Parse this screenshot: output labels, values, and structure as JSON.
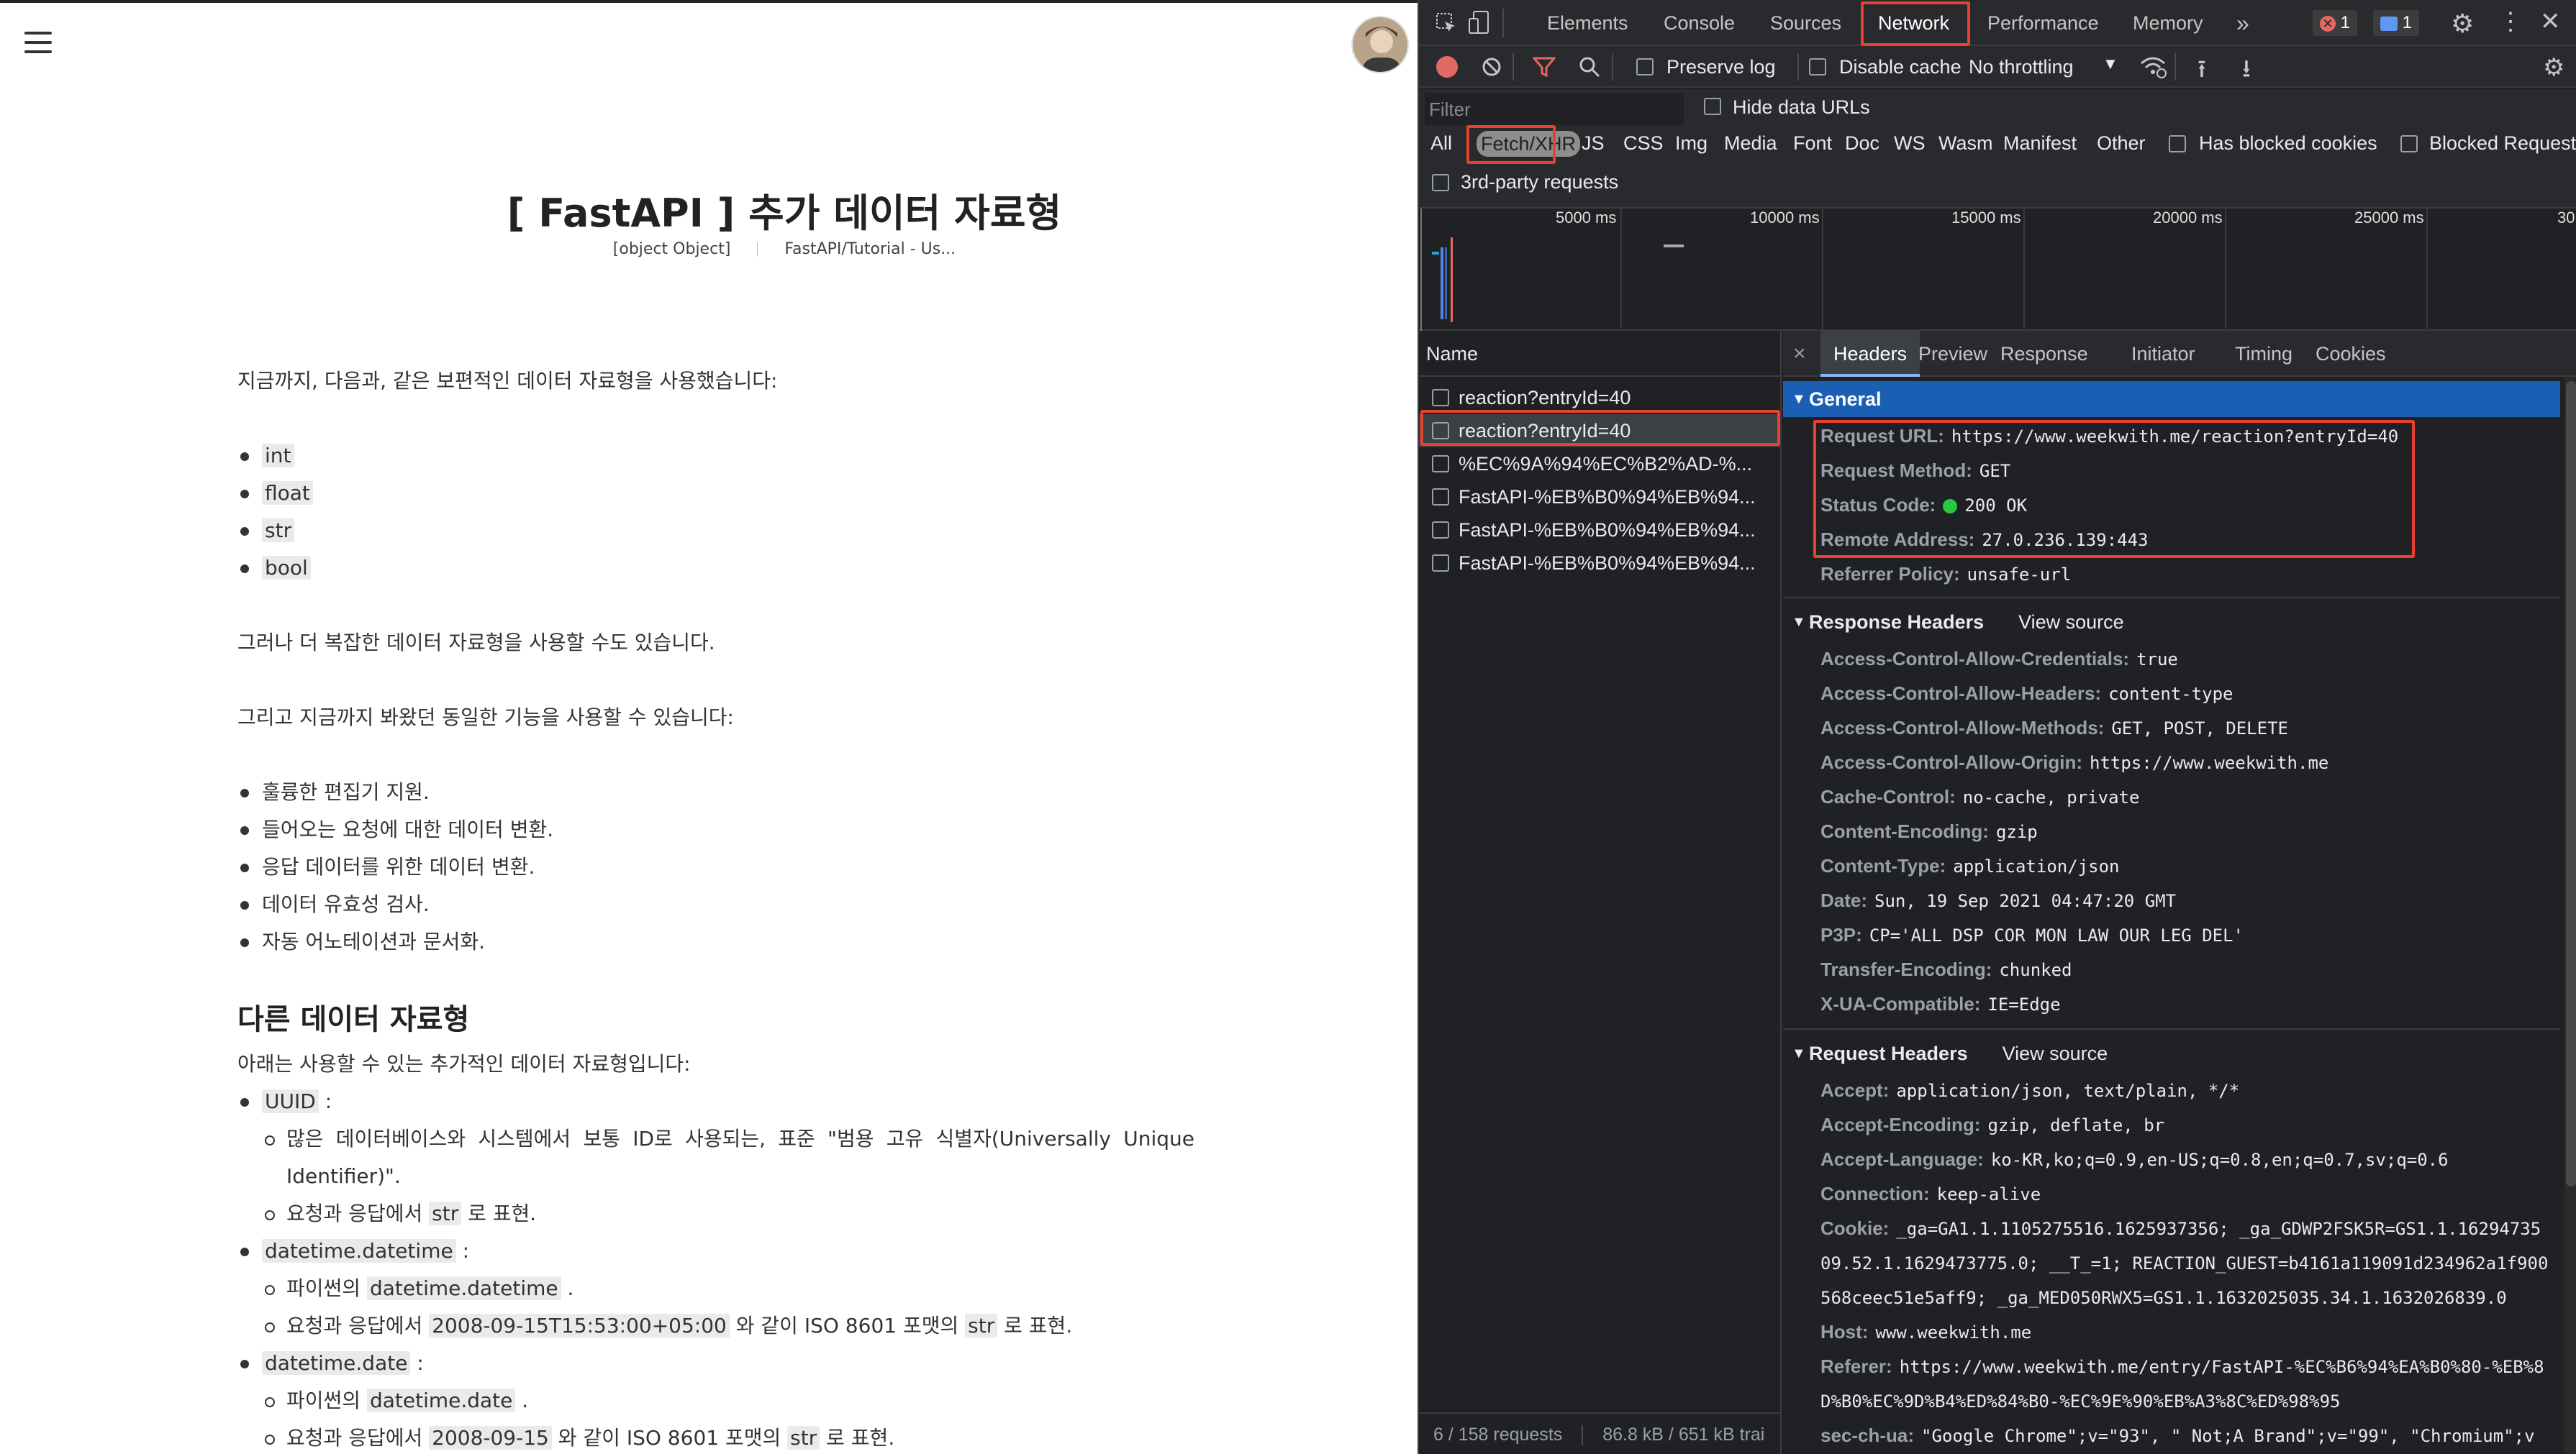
{
  "blog": {
    "title": "[ FastAPI ] 추가 데이터 자료형",
    "date": {
      "name": "datetime.date",
      "colon": " :",
      "py_pre": "파이썬의 ",
      "py_code": "datetime.date",
      "py_post": " .",
      "ex_pre": "요청과 응답에서 ",
      "ex_code": "2008-09-15",
      "ex_mid": " 와 같이 ISO 8601 포맷의 ",
      "ex_code2": "str",
      "ex_post": " 로 표현."
    },
    "category": "FastAPI/Tutorial - Us...",
    "intro": "지금까지, 다음과, 같은 보편적인 데이터 자료형을 사용했습니다:",
    "basic_types": [
      "int",
      "float",
      "str",
      "bool"
    ],
    "p2": "그러나 더 복잡한 데이터 자료형을 사용할 수도 있습니다.",
    "p3": "그리고 지금까지 봐왔던 동일한 기능을 사용할 수 있습니다:",
    "features": [
      "훌륭한 편집기 지원.",
      "들어오는 요청에 대한 데이터 변환.",
      "응답 데이터를 위한 데이터 변환.",
      "데이터 유효성 검사.",
      "자동 어노테이션과 문서화."
    ],
    "h2": "다른 데이터 자료형",
    "h2_desc": "아래는 사용할 수 있는 추가적인 데이터 자료형입니다:",
    "uuid": {
      "name": "UUID",
      "colon": " :",
      "desc": "많은 데이터베이스와 시스템에서 보통 ID로 사용되는, 표준 \"범용 고유 식별자(Universally Unique Identifier)\".",
      "repr_pre": "요청과 응답에서 ",
      "repr_code": "str",
      "repr_post": " 로 표현."
    },
    "datetime": {
      "name": "datetime.datetime",
      "colon": " :",
      "py_pre": "파이썬의 ",
      "py_code": "datetime.datetime",
      "py_post": " .",
      "ex_pre": "요청과 응답에서 ",
      "ex_code": "2008-09-15T15:53:00+05:00",
      "ex_mid": " 와 같이 ISO 8601 포맷의 ",
      "ex_code2": "str",
      "ex_post": " 로 표현."
    }
  },
  "devtools": {
    "tabs": [
      "Elements",
      "Console",
      "Sources",
      "Network",
      "Performance",
      "Memory"
    ],
    "active_tab": "Network",
    "more": "»",
    "error_count": "1",
    "message_count": "1",
    "toolbar": {
      "preserve_log": "Preserve log",
      "disable_cache": "Disable cache",
      "throttling": "No throttling"
    },
    "filter": {
      "placeholder": "Filter",
      "hide_data_urls": "Hide data URLs",
      "types": [
        "All",
        "Fetch/XHR",
        "JS",
        "CSS",
        "Img",
        "Media",
        "Font",
        "Doc",
        "WS",
        "Wasm",
        "Manifest",
        "Other"
      ],
      "active_type": "Fetch/XHR",
      "has_blocked_cookies": "Has blocked cookies",
      "blocked_requests": "Blocked Requests",
      "third_party": "3rd-party requests"
    },
    "timeline_ticks": [
      "5000 ms",
      "10000 ms",
      "15000 ms",
      "20000 ms",
      "25000 ms",
      "30"
    ],
    "requests_header": "Name",
    "requests": [
      "reaction?entryId=40",
      "reaction?entryId=40",
      "%EC%9A%94%EC%B2%AD-%...",
      "FastAPI-%EB%B0%94%EB%94...",
      "FastAPI-%EB%B0%94%EB%94...",
      "FastAPI-%EB%B0%94%EB%94..."
    ],
    "selected_request_index": 1,
    "footer_requests": "6 / 158 requests",
    "footer_size": "86.8 kB / 651 kB trai",
    "detail_tabs": [
      "Headers",
      "Preview",
      "Response",
      "Initiator",
      "Timing",
      "Cookies"
    ],
    "close_glyph": "×",
    "general": {
      "title": "General",
      "rows": [
        {
          "k": "Request URL:",
          "v": "https://www.weekwith.me/reaction?entryId=40"
        },
        {
          "k": "Request Method:",
          "v": "GET"
        },
        {
          "k": "Status Code:",
          "v": "200 OK"
        },
        {
          "k": "Remote Address:",
          "v": "27.0.236.139:443"
        },
        {
          "k": "Referrer Policy:",
          "v": "unsafe-url"
        }
      ]
    },
    "response_headers": {
      "title": "Response Headers",
      "view_source": "View source",
      "rows": [
        {
          "k": "Access-Control-Allow-Credentials:",
          "v": "true"
        },
        {
          "k": "Access-Control-Allow-Headers:",
          "v": "content-type"
        },
        {
          "k": "Access-Control-Allow-Methods:",
          "v": "GET, POST, DELETE"
        },
        {
          "k": "Access-Control-Allow-Origin:",
          "v": "https://www.weekwith.me"
        },
        {
          "k": "Cache-Control:",
          "v": "no-cache, private"
        },
        {
          "k": "Content-Encoding:",
          "v": "gzip"
        },
        {
          "k": "Content-Type:",
          "v": "application/json"
        },
        {
          "k": "Date:",
          "v": "Sun, 19 Sep 2021 04:47:20 GMT"
        },
        {
          "k": "P3P:",
          "v": "CP='ALL DSP COR MON LAW OUR LEG DEL'"
        },
        {
          "k": "Transfer-Encoding:",
          "v": "chunked"
        },
        {
          "k": "X-UA-Compatible:",
          "v": "IE=Edge"
        }
      ]
    },
    "request_headers": {
      "title": "Request Headers",
      "view_source": "View source",
      "accept_k": "Accept:",
      "accept_v": "application/json, text/plain, */*",
      "enc_k": "Accept-Encoding:",
      "enc_v": "gzip, deflate, br",
      "lang_k": "Accept-Language:",
      "lang_v": "ko-KR,ko;q=0.9,en-US;q=0.8,en;q=0.7,sv;q=0.6",
      "conn_k": "Connection:",
      "conn_v": "keep-alive",
      "cookie_k": "Cookie:",
      "cookie_v1": "_ga=GA1.1.1105275516.1625937356; _ga_GDWP2FSK5R=GS1.1.16294735",
      "cookie_v2": "09.52.1.1629473775.0; __T_=1; REACTION_GUEST=b4161a119091d234962a1f900",
      "cookie_v3": "568ceec51e5aff9; _ga_MED050RWX5=GS1.1.1632025035.34.1.1632026839.0",
      "host_k": "Host:",
      "host_v": "www.weekwith.me",
      "ref_k": "Referer:",
      "ref_v1": "https://www.weekwith.me/entry/FastAPI-%EC%B6%94%EA%B0%80-%EB%8",
      "ref_v2": "D%B0%EC%9D%B4%ED%84%B0-%EC%9E%90%EB%A3%8C%ED%98%95",
      "ua_k": "sec-ch-ua:",
      "ua_v": "\"Google Chrome\";v=\"93\", \" Not;A Brand\";v=\"99\", \"Chromium\";v"
    }
  }
}
